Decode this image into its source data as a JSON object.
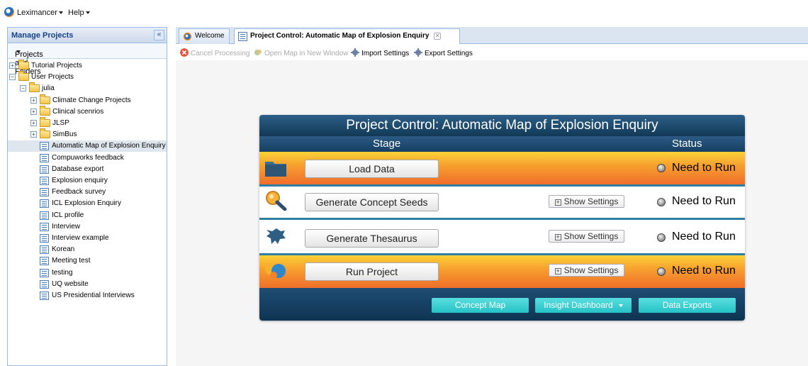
{
  "menubar": {
    "app_menu": "Leximancer",
    "help_menu": "Help"
  },
  "left_panel": {
    "title": "Manage Projects",
    "collapse_glyph": "«",
    "toolbar_label": "Projects and Folders",
    "tree": [
      {
        "label": "Tutorial Projects",
        "type": "folder",
        "expander": "+"
      },
      {
        "label": "User Projects",
        "type": "folder",
        "expander": "−"
      },
      {
        "label": "julia",
        "type": "folder",
        "expander": "−"
      },
      {
        "label": "Climate Change Projects",
        "type": "folder",
        "expander": "+"
      },
      {
        "label": "Clinical scenrios",
        "type": "folder",
        "expander": "+"
      },
      {
        "label": "JLSP",
        "type": "folder",
        "expander": "+"
      },
      {
        "label": "SimBus",
        "type": "folder",
        "expander": "+"
      },
      {
        "label": "Automatic Map of Explosion Enquiry",
        "type": "project",
        "selected": true
      },
      {
        "label": "Compuworks feedback",
        "type": "project"
      },
      {
        "label": "Database export",
        "type": "project"
      },
      {
        "label": "Explosion enquiry",
        "type": "project"
      },
      {
        "label": "Feedback survey",
        "type": "project"
      },
      {
        "label": "ICL Explosion Enquiry",
        "type": "project"
      },
      {
        "label": "ICL profile",
        "type": "project"
      },
      {
        "label": "Interview",
        "type": "project"
      },
      {
        "label": "Interview example",
        "type": "project"
      },
      {
        "label": "Korean",
        "type": "project"
      },
      {
        "label": "Meeting test",
        "type": "project"
      },
      {
        "label": "testing",
        "type": "project"
      },
      {
        "label": "UQ website",
        "type": "project"
      },
      {
        "label": "US Presidential Interviews",
        "type": "project"
      }
    ]
  },
  "tabs": [
    {
      "label": "Welcome",
      "active": false
    },
    {
      "label": "Project Control: Automatic Map of Explosion Enquiry",
      "active": true,
      "close_glyph": "✕"
    }
  ],
  "toolbar": {
    "cancel": "Cancel Processing",
    "open_map": "Open Map in New Window",
    "import": "Import Settings",
    "export": "Export Settings"
  },
  "project_control": {
    "title": "Project Control: Automatic Map of Explosion Enquiry",
    "stage_header": "Stage",
    "status_header": "Status",
    "rows": [
      {
        "button": "Load Data",
        "status": "Need to Run",
        "has_settings": false,
        "icon": "folder-icon"
      },
      {
        "button": "Generate Concept Seeds",
        "status": "Need to Run",
        "has_settings": true,
        "icon": "magnifier-icon"
      },
      {
        "button": "Generate Thesaurus",
        "status": "Need to Run",
        "has_settings": true,
        "icon": "thesaurus-icon"
      },
      {
        "button": "Run Project",
        "status": "Need to Run",
        "has_settings": true,
        "icon": "run-project-icon"
      }
    ],
    "settings_label": "Show Settings",
    "settings_plus": "+",
    "footer": {
      "concept_map": "Concept Map",
      "insight_dashboard": "Insight Dashboard",
      "data_exports": "Data Exports"
    }
  },
  "colors": {
    "header_dark": "#123956",
    "accent_orange": "#ef6e2b",
    "accent_yellow": "#fbd238",
    "footer_button": "#25c2c6",
    "panel_border": "#99bbe8"
  }
}
